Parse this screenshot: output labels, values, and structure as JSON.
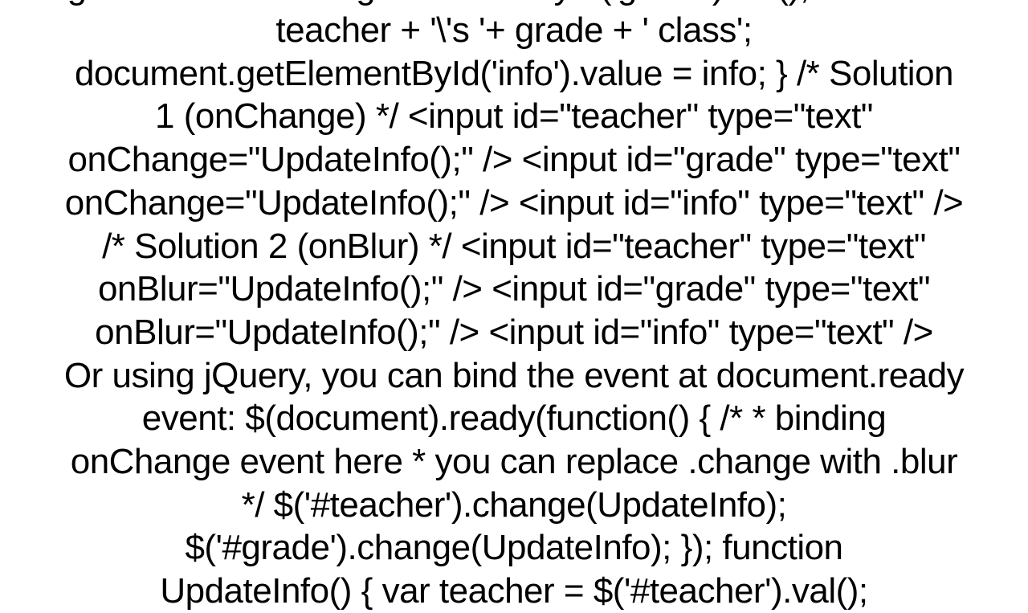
{
  "text": {
    "line0": "grade = document.getElementById('grade').val();   var info =",
    "line1": "teacher + '\\'s '+ grade + ' class';",
    "line2": "document.getElementById('info').value = info; }  /* Solution",
    "line3": "1 (onChange) */ <input id=\"teacher\" type=\"text\"",
    "line4": "onChange=\"UpdateInfo();\" /> <input id=\"grade\" type=\"text\"",
    "line5": "onChange=\"UpdateInfo();\" /> <input id=\"info\" type=\"text\" />",
    "line6": "/* Solution 2 (onBlur) */ <input id=\"teacher\" type=\"text\"",
    "line7": "onBlur=\"UpdateInfo();\" /> <input id=\"grade\" type=\"text\"",
    "line8": "onBlur=\"UpdateInfo();\" /> <input id=\"info\" type=\"text\" />",
    "line9": "Or using jQuery, you can bind the event at document.ready",
    "line10": "event: $(document).ready(function() {     /*      * binding",
    "line11": "onChange event here      * you can replace .change with .blur",
    "line12": "*/     $('#teacher').change(UpdateInfo);",
    "line13": "$('#grade').change(UpdateInfo); });      function",
    "line14": "UpdateInfo() {     var teacher = $('#teacher').val();"
  }
}
